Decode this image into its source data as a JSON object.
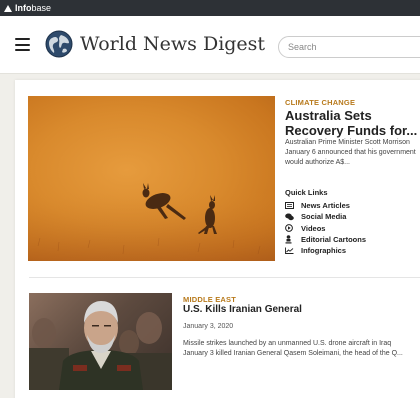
{
  "brand": {
    "name_bold": "Info",
    "name_light": "base"
  },
  "header": {
    "site_title": "World News Digest",
    "search_placeholder": "Search"
  },
  "feature": {
    "category": "CLIMATE CHANGE",
    "title": "Australia Sets Recovery Funds for...",
    "summary": "Australian Prime Minister Scott Morrison January 6 announced that his government would authorize A$...",
    "quick_links_heading": "Quick Links",
    "quick_links": [
      {
        "label": "News Articles",
        "icon": "newspaper-icon"
      },
      {
        "label": "Social Media",
        "icon": "chat-bubbles-icon"
      },
      {
        "label": "Videos",
        "icon": "play-circle-icon"
      },
      {
        "label": "Editorial Cartoons",
        "icon": "cartoon-figure-icon"
      },
      {
        "label": "Infographics",
        "icon": "line-chart-icon"
      }
    ]
  },
  "second_story": {
    "category": "MIDDLE EAST",
    "title": "U.S. Kills Iranian General",
    "date": "January 3, 2020",
    "summary_line1": "Missile strikes launched by an unmanned U.S. drone aircraft in Iraq",
    "summary_line2": "January 3 killed Iranian General Qasem Soleimani, the head of the Q..."
  },
  "colors": {
    "brand_bar": "#2d3136",
    "category_accent": "#b87a1c",
    "page_background": "#f0efea"
  }
}
